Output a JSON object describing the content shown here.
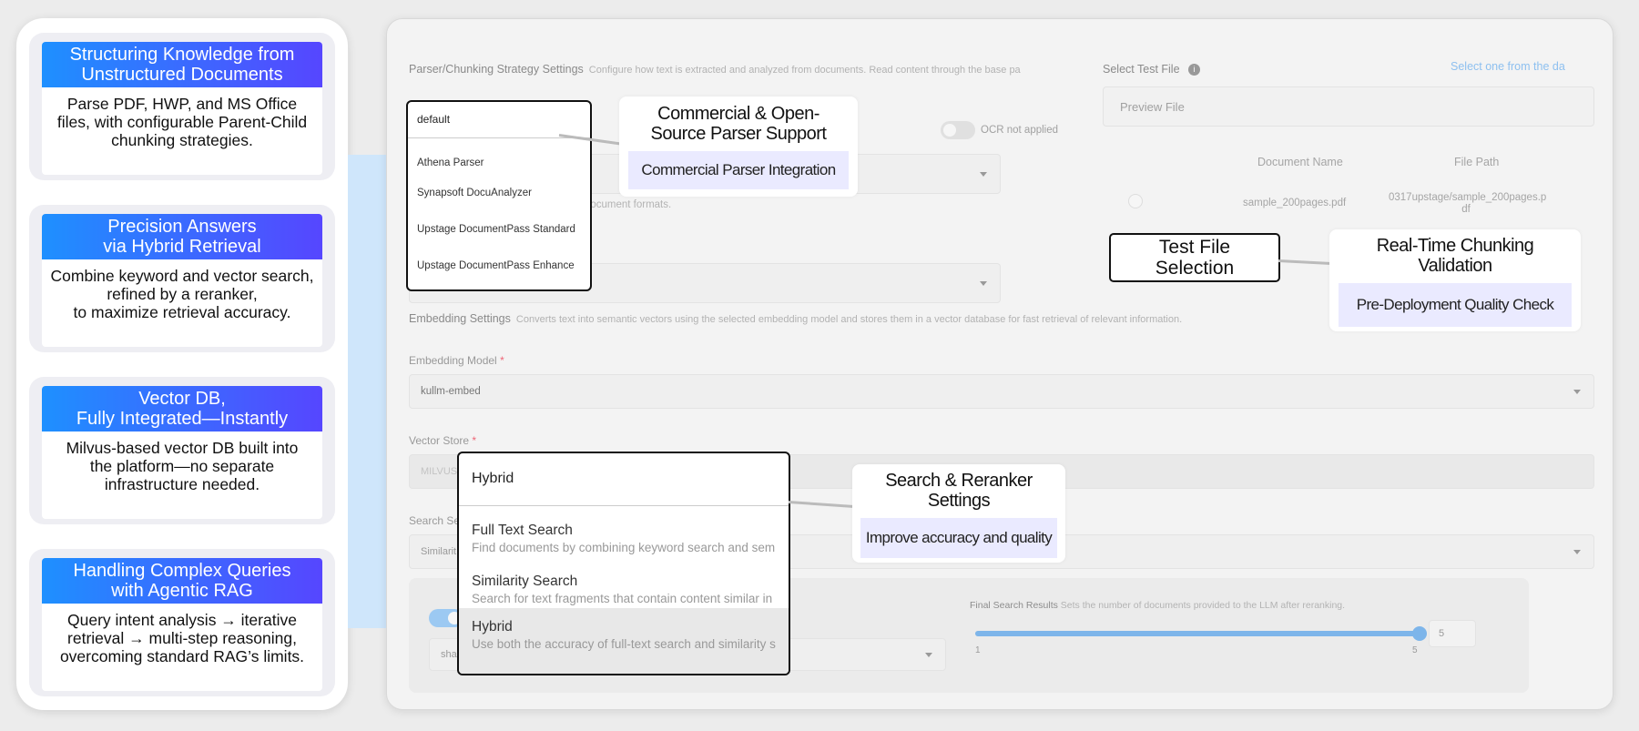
{
  "features": [
    {
      "title": "Structuring Knowledge from\nUnstructured Documents",
      "desc": "Parse PDF, HWP, and MS Office\nfiles, with configurable Parent-Child\nchunking strategies."
    },
    {
      "title": "Precision Answers\nvia Hybrid Retrieval",
      "desc": "Combine keyword and vector search,\nrefined by a reranker,\nto maximize retrieval accuracy."
    },
    {
      "title": "Vector DB,\nFully Integrated—Instantly",
      "desc": "Milvus-based vector DB built into\nthe platform—no separate\ninfrastructure needed."
    },
    {
      "title": "Handling Complex Queries\nwith Agentic RAG",
      "desc": "Query intent analysis → iterative\nretrieval → multi-step reasoning,\novercoming standard RAG’s limits."
    }
  ],
  "parser": {
    "section_title": "Parser/Chunking Strategy Settings",
    "section_desc": "Configure how text is extracted and analyzed from documents. Read content through the base pa",
    "ocr_label": "OCR not applied",
    "formats_hint": "s document formats.",
    "dropdown": {
      "selected": "default",
      "options": [
        "Athena Parser",
        "Synapsoft DocuAnalyzer",
        "Upstage DocumentPass Standard",
        "Upstage DocumentPass Enhance"
      ]
    }
  },
  "test_file": {
    "label": "Select Test File",
    "link": "Select one from the da",
    "preview": "Preview File",
    "col_name": "Document Name",
    "col_path": "File Path",
    "row": {
      "name": "sample_200pages.pdf",
      "path": "0317upstage/sample_200pages.p\ndf"
    }
  },
  "embedding": {
    "section_title": "Embedding Settings",
    "section_desc": "Converts text into semantic vectors using the selected embedding model and stores them in a vector database for fast retrieval of relevant information.",
    "model_label": "Embedding Model",
    "model_value": "kullm-embed",
    "store_label": "Vector Store",
    "store_value": "MILVUS",
    "search_label": "Search Se",
    "search_value": "Similarit"
  },
  "search_dropdown": {
    "selected": "Hybrid",
    "options": [
      {
        "name": "Full Text Search",
        "desc": "Find documents by combining keyword search and sem"
      },
      {
        "name": "Similarity Search",
        "desc": "Search for text fragments that contain content similar in"
      },
      {
        "name": "Hybrid",
        "desc": "Use both the accuracy of full-text search and similarity s"
      }
    ]
  },
  "final_results": {
    "label": "Final Search Results",
    "desc": "Sets the number of documents provided to the LLM after reranking.",
    "min": "1",
    "max": "5",
    "value": "5",
    "reranker_value": "sha"
  },
  "callouts": {
    "parser": {
      "title": "Commercial & Open-\nSource Parser Support",
      "sub": "Commercial Parser Integration"
    },
    "test_file": "Test File\nSelection",
    "chunking": {
      "title": "Real-Time Chunking\nValidation",
      "sub": "Pre-Deployment Quality Check"
    },
    "search": {
      "title": "Search & Reranker\nSettings",
      "sub": "Improve accuracy and quality"
    }
  },
  "colors": {
    "title_gradient_start": "#1e90ff",
    "title_gradient_end": "#5646ff",
    "callout_sub_bg": "#eaeaff",
    "slider": "#7db5ea"
  }
}
